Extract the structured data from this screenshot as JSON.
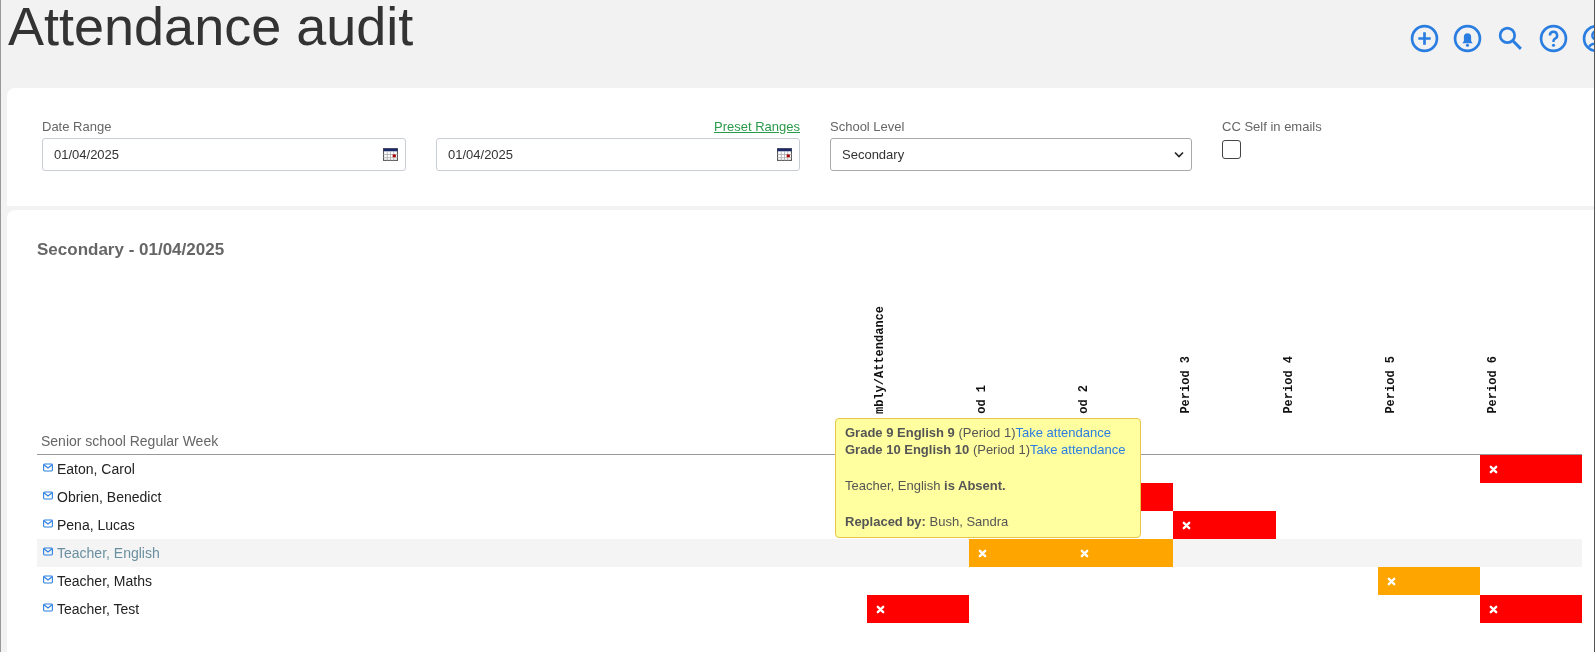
{
  "page": {
    "title": "Attendance audit"
  },
  "filters": {
    "date_range": {
      "label": "Date Range",
      "from": "01/04/2025",
      "to": "01/04/2025",
      "preset_link": "Preset Ranges"
    },
    "school_level": {
      "label": "School Level",
      "value": "Secondary"
    },
    "cc_self": {
      "label": "CC Self in emails",
      "checked": false
    }
  },
  "report": {
    "heading": "Secondary - 01/04/2025",
    "timetable": "Senior school Regular Week",
    "columns": [
      "mbly/Attendance",
      "od 1",
      "od 2",
      "Period 3",
      "Period 4",
      "Period 5",
      "Period 6"
    ],
    "rows": [
      {
        "name": "Eaton, Carol",
        "highlighted": false,
        "cells": [
          null,
          null,
          null,
          null,
          null,
          null,
          {
            "color": "#ff0000"
          }
        ]
      },
      {
        "name": "Obrien, Benedict",
        "highlighted": false,
        "cells": [
          null,
          null,
          {
            "color": "#ff0000"
          },
          null,
          null,
          null,
          null
        ]
      },
      {
        "name": "Pena, Lucas",
        "highlighted": false,
        "cells": [
          null,
          null,
          null,
          {
            "color": "#ff0000"
          },
          null,
          null,
          null
        ]
      },
      {
        "name": "Teacher, English",
        "highlighted": true,
        "cells": [
          null,
          {
            "color": "#ffa500"
          },
          {
            "color": "#ffa500"
          },
          null,
          null,
          null,
          null
        ]
      },
      {
        "name": "Teacher, Maths",
        "highlighted": false,
        "cells": [
          null,
          null,
          null,
          null,
          null,
          {
            "color": "#ffa500"
          },
          null
        ]
      },
      {
        "name": "Teacher, Test",
        "highlighted": false,
        "cells": [
          {
            "color": "#ff0000"
          },
          null,
          null,
          null,
          null,
          null,
          {
            "color": "#ff0000"
          }
        ]
      }
    ],
    "tooltip": {
      "classes": [
        {
          "text": "**Grade 9 English 9** (Period 1)",
          "link": "Take attendance"
        },
        {
          "text": "**Grade 10 English 10** (Period 1)",
          "link": "Take attendance"
        }
      ],
      "absence": "Teacher, English **is Absent.**",
      "replacement": "**Replaced by:** Bush, Sandra"
    }
  }
}
